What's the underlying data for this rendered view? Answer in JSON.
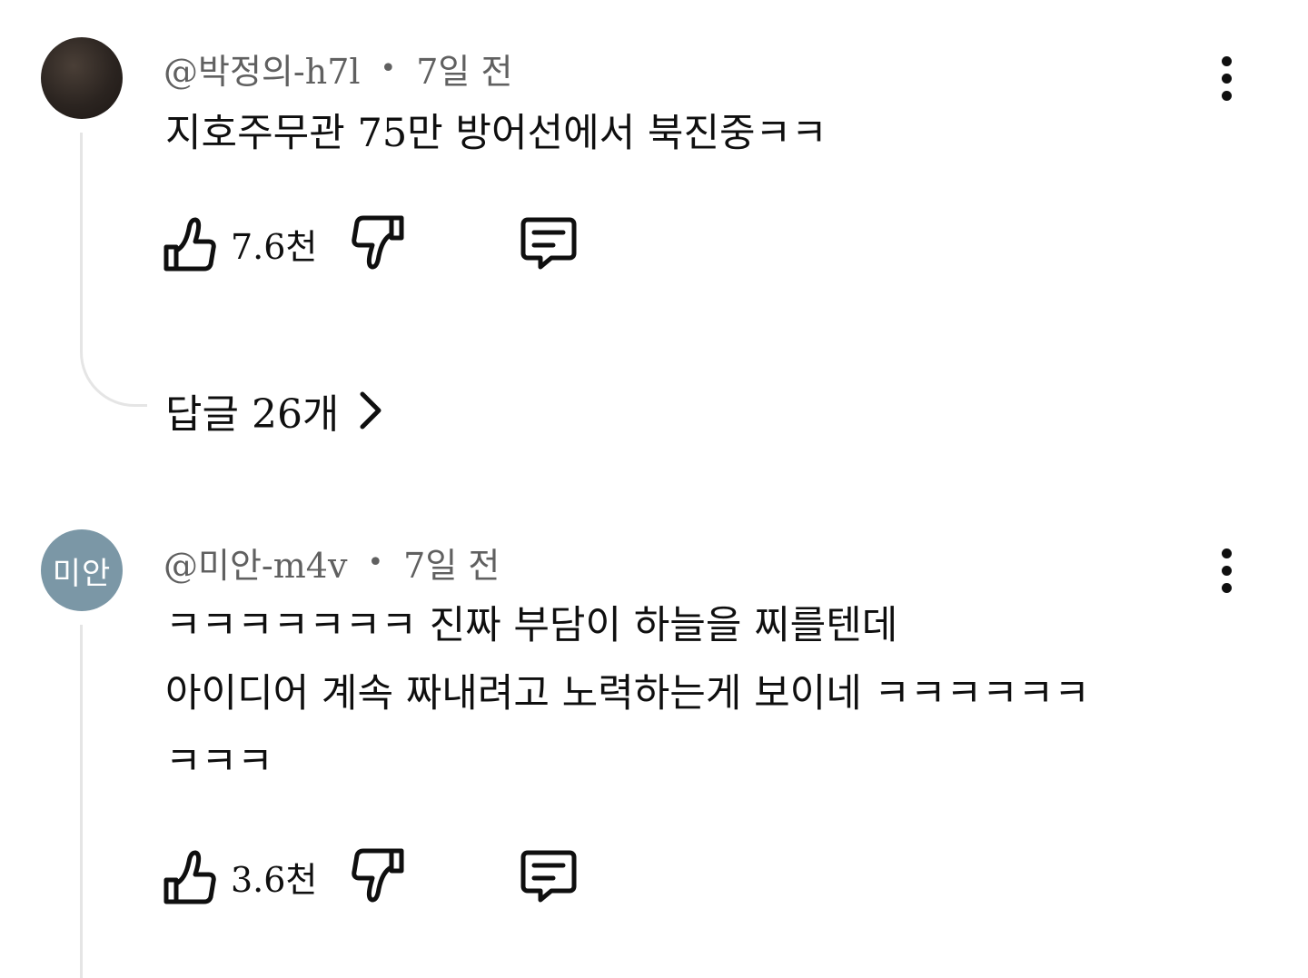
{
  "comments": [
    {
      "handle": "@박정의-h7l",
      "time": "7일 전",
      "avatar_initials": "",
      "text_lines": [
        "지호주무관 75만 방어선에서 북진중ㅋㅋ"
      ],
      "likes": "7.6천",
      "replies_label": "답글 26개"
    },
    {
      "handle": "@미안-m4v",
      "time": "7일 전",
      "avatar_initials": "미안",
      "text_lines": [
        "ㅋㅋㅋㅋㅋㅋㅋ 진짜 부담이 하늘을 찌를텐데",
        "아이디어 계속 짜내려고 노력하는게 보이네 ㅋㅋㅋㅋㅋㅋ",
        "ㅋㅋㅋ"
      ],
      "likes": "3.6천"
    }
  ],
  "separator": "•",
  "icons": {
    "like": "thumbs-up-icon",
    "dislike": "thumbs-down-icon",
    "reply": "comment-icon",
    "more": "vertical-ellipsis-icon",
    "chevron": "chevron-right-icon"
  },
  "colors": {
    "avatar_initials_bg": "#7b97a6",
    "meta_text": "#606060",
    "thread_line": "#e5e5e5"
  }
}
